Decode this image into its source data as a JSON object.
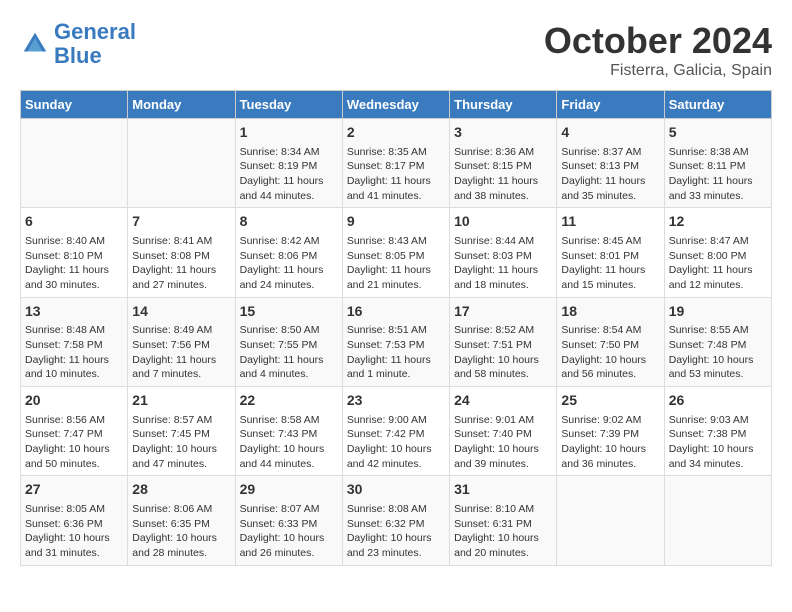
{
  "header": {
    "logo_line1": "General",
    "logo_line2": "Blue",
    "month": "October 2024",
    "location": "Fisterra, Galicia, Spain"
  },
  "weekdays": [
    "Sunday",
    "Monday",
    "Tuesday",
    "Wednesday",
    "Thursday",
    "Friday",
    "Saturday"
  ],
  "weeks": [
    [
      {
        "day": "",
        "info": ""
      },
      {
        "day": "",
        "info": ""
      },
      {
        "day": "1",
        "info": "Sunrise: 8:34 AM\nSunset: 8:19 PM\nDaylight: 11 hours and 44 minutes."
      },
      {
        "day": "2",
        "info": "Sunrise: 8:35 AM\nSunset: 8:17 PM\nDaylight: 11 hours and 41 minutes."
      },
      {
        "day": "3",
        "info": "Sunrise: 8:36 AM\nSunset: 8:15 PM\nDaylight: 11 hours and 38 minutes."
      },
      {
        "day": "4",
        "info": "Sunrise: 8:37 AM\nSunset: 8:13 PM\nDaylight: 11 hours and 35 minutes."
      },
      {
        "day": "5",
        "info": "Sunrise: 8:38 AM\nSunset: 8:11 PM\nDaylight: 11 hours and 33 minutes."
      }
    ],
    [
      {
        "day": "6",
        "info": "Sunrise: 8:40 AM\nSunset: 8:10 PM\nDaylight: 11 hours and 30 minutes."
      },
      {
        "day": "7",
        "info": "Sunrise: 8:41 AM\nSunset: 8:08 PM\nDaylight: 11 hours and 27 minutes."
      },
      {
        "day": "8",
        "info": "Sunrise: 8:42 AM\nSunset: 8:06 PM\nDaylight: 11 hours and 24 minutes."
      },
      {
        "day": "9",
        "info": "Sunrise: 8:43 AM\nSunset: 8:05 PM\nDaylight: 11 hours and 21 minutes."
      },
      {
        "day": "10",
        "info": "Sunrise: 8:44 AM\nSunset: 8:03 PM\nDaylight: 11 hours and 18 minutes."
      },
      {
        "day": "11",
        "info": "Sunrise: 8:45 AM\nSunset: 8:01 PM\nDaylight: 11 hours and 15 minutes."
      },
      {
        "day": "12",
        "info": "Sunrise: 8:47 AM\nSunset: 8:00 PM\nDaylight: 11 hours and 12 minutes."
      }
    ],
    [
      {
        "day": "13",
        "info": "Sunrise: 8:48 AM\nSunset: 7:58 PM\nDaylight: 11 hours and 10 minutes."
      },
      {
        "day": "14",
        "info": "Sunrise: 8:49 AM\nSunset: 7:56 PM\nDaylight: 11 hours and 7 minutes."
      },
      {
        "day": "15",
        "info": "Sunrise: 8:50 AM\nSunset: 7:55 PM\nDaylight: 11 hours and 4 minutes."
      },
      {
        "day": "16",
        "info": "Sunrise: 8:51 AM\nSunset: 7:53 PM\nDaylight: 11 hours and 1 minute."
      },
      {
        "day": "17",
        "info": "Sunrise: 8:52 AM\nSunset: 7:51 PM\nDaylight: 10 hours and 58 minutes."
      },
      {
        "day": "18",
        "info": "Sunrise: 8:54 AM\nSunset: 7:50 PM\nDaylight: 10 hours and 56 minutes."
      },
      {
        "day": "19",
        "info": "Sunrise: 8:55 AM\nSunset: 7:48 PM\nDaylight: 10 hours and 53 minutes."
      }
    ],
    [
      {
        "day": "20",
        "info": "Sunrise: 8:56 AM\nSunset: 7:47 PM\nDaylight: 10 hours and 50 minutes."
      },
      {
        "day": "21",
        "info": "Sunrise: 8:57 AM\nSunset: 7:45 PM\nDaylight: 10 hours and 47 minutes."
      },
      {
        "day": "22",
        "info": "Sunrise: 8:58 AM\nSunset: 7:43 PM\nDaylight: 10 hours and 44 minutes."
      },
      {
        "day": "23",
        "info": "Sunrise: 9:00 AM\nSunset: 7:42 PM\nDaylight: 10 hours and 42 minutes."
      },
      {
        "day": "24",
        "info": "Sunrise: 9:01 AM\nSunset: 7:40 PM\nDaylight: 10 hours and 39 minutes."
      },
      {
        "day": "25",
        "info": "Sunrise: 9:02 AM\nSunset: 7:39 PM\nDaylight: 10 hours and 36 minutes."
      },
      {
        "day": "26",
        "info": "Sunrise: 9:03 AM\nSunset: 7:38 PM\nDaylight: 10 hours and 34 minutes."
      }
    ],
    [
      {
        "day": "27",
        "info": "Sunrise: 8:05 AM\nSunset: 6:36 PM\nDaylight: 10 hours and 31 minutes."
      },
      {
        "day": "28",
        "info": "Sunrise: 8:06 AM\nSunset: 6:35 PM\nDaylight: 10 hours and 28 minutes."
      },
      {
        "day": "29",
        "info": "Sunrise: 8:07 AM\nSunset: 6:33 PM\nDaylight: 10 hours and 26 minutes."
      },
      {
        "day": "30",
        "info": "Sunrise: 8:08 AM\nSunset: 6:32 PM\nDaylight: 10 hours and 23 minutes."
      },
      {
        "day": "31",
        "info": "Sunrise: 8:10 AM\nSunset: 6:31 PM\nDaylight: 10 hours and 20 minutes."
      },
      {
        "day": "",
        "info": ""
      },
      {
        "day": "",
        "info": ""
      }
    ]
  ]
}
